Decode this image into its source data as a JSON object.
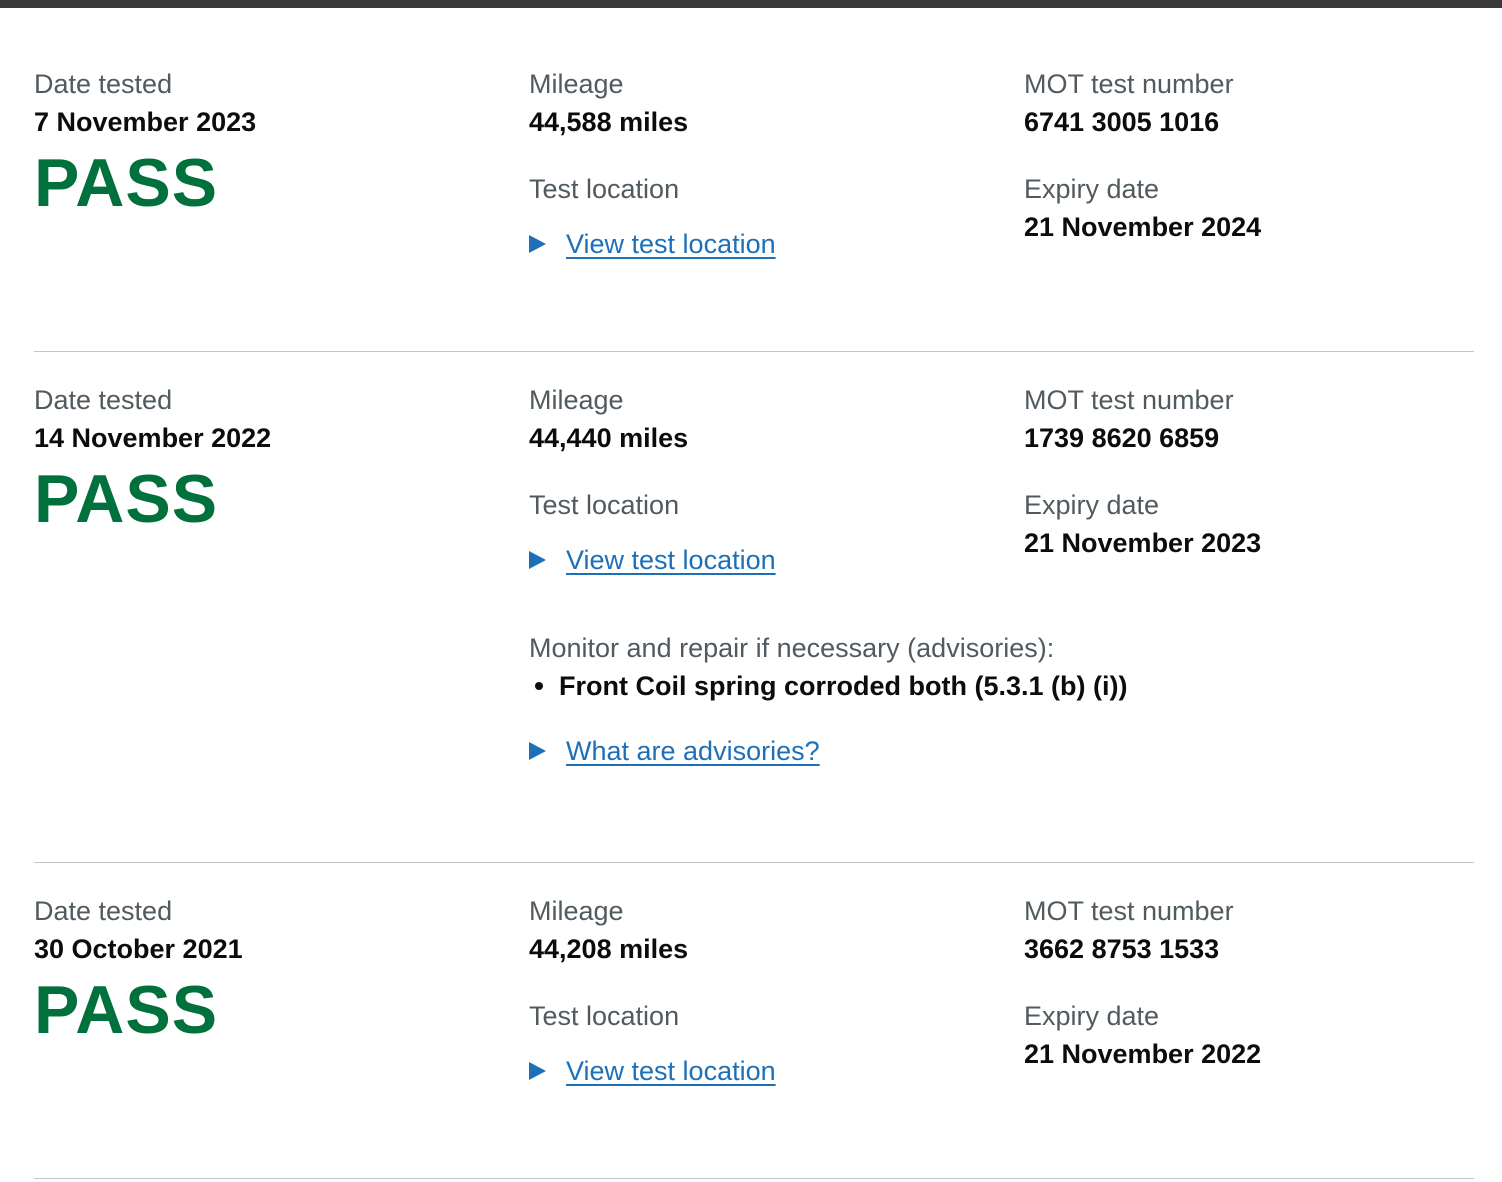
{
  "labels": {
    "date_tested": "Date tested",
    "mileage": "Mileage",
    "mot_test_number": "MOT test number",
    "test_location": "Test location",
    "expiry_date": "Expiry date",
    "view_test_location": "View test location",
    "advisories_heading": "Monitor and repair if necessary (advisories):",
    "what_are_advisories": "What are advisories?"
  },
  "records": [
    {
      "date_tested": "7 November 2023",
      "result": "PASS",
      "mileage": "44,588 miles",
      "mot_test_number": "6741 3005 1016",
      "expiry_date": "21 November 2024",
      "advisories": []
    },
    {
      "date_tested": "14 November 2022",
      "result": "PASS",
      "mileage": "44,440 miles",
      "mot_test_number": "1739 8620 6859",
      "expiry_date": "21 November 2023",
      "advisories": [
        "Front Coil spring corroded both (5.3.1 (b) (i))"
      ]
    },
    {
      "date_tested": "30 October 2021",
      "result": "PASS",
      "mileage": "44,208 miles",
      "mot_test_number": "3662 8753 1533",
      "expiry_date": "21 November 2022",
      "advisories": []
    }
  ],
  "colors": {
    "pass": "#00703c",
    "link": "#1d70b8",
    "label": "#505a5f",
    "text": "#0b0c0c",
    "divider": "#c4c4c4",
    "top_bar": "#3a3a3a"
  }
}
